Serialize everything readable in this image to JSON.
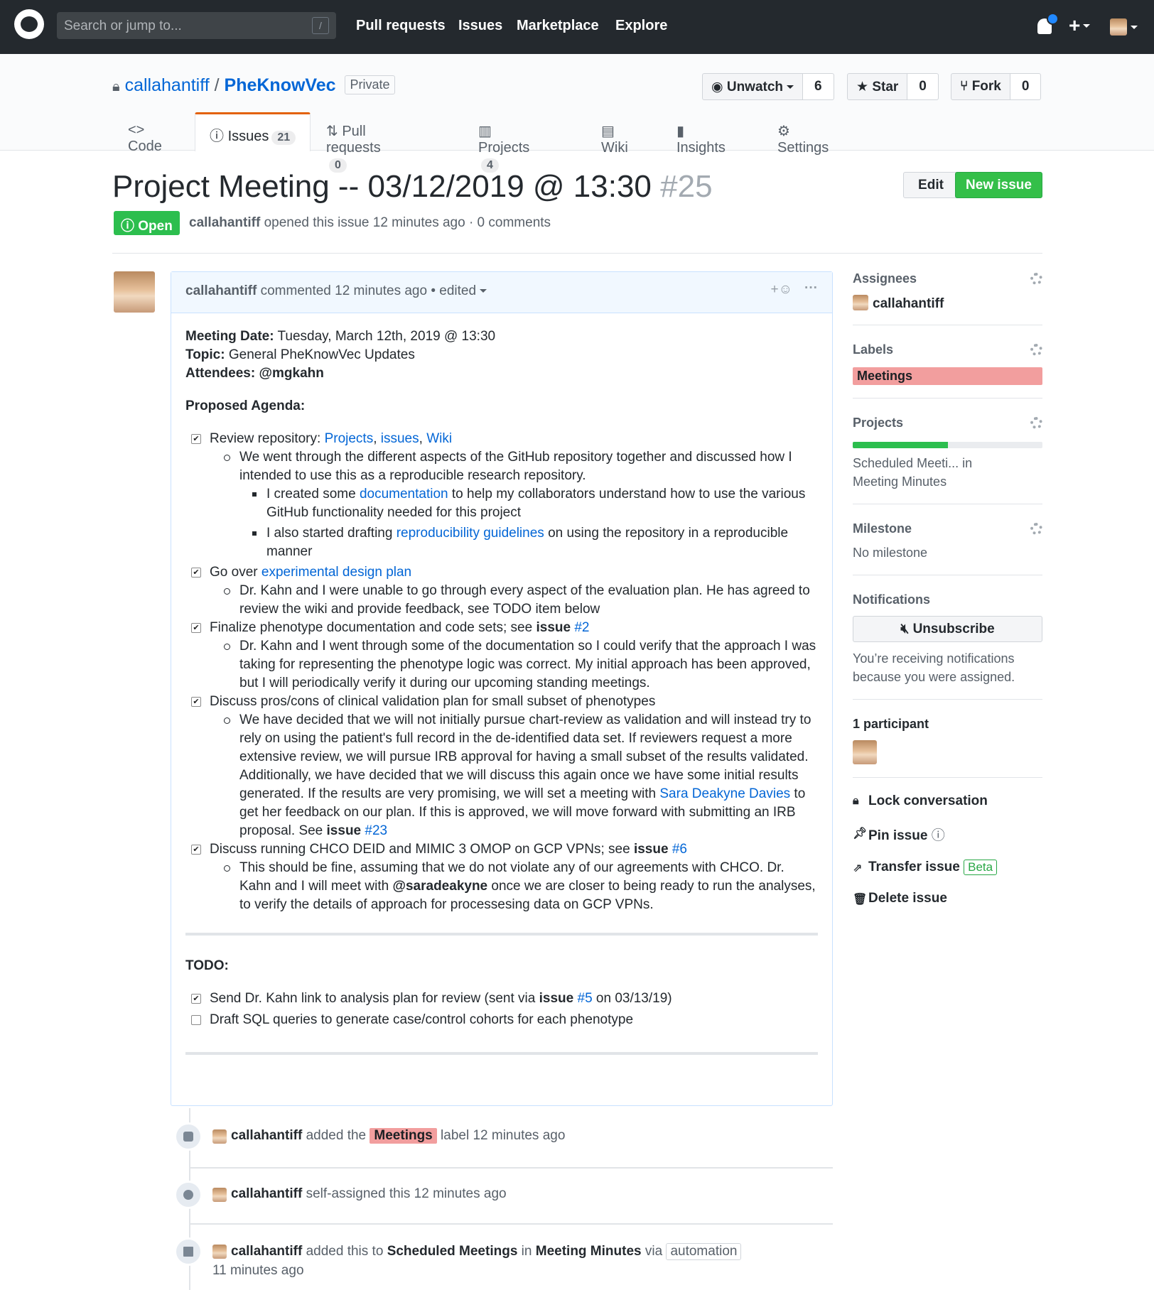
{
  "header": {
    "search_placeholder": "Search or jump to...",
    "slash": "/",
    "nav": [
      "Pull requests",
      "Issues",
      "Marketplace",
      "Explore"
    ],
    "plus": "+"
  },
  "repo": {
    "owner": "callahantiff",
    "sep": "/",
    "name": "PheKnowVec",
    "visibility": "Private",
    "unwatch": "Unwatch",
    "watch_count": "6",
    "star": "Star",
    "star_count": "0",
    "fork": "Fork",
    "fork_count": "0"
  },
  "tabs": [
    {
      "label": "Code",
      "count": ""
    },
    {
      "label": "Issues",
      "count": "21"
    },
    {
      "label": "Pull requests",
      "count": "0"
    },
    {
      "label": "Projects",
      "count": "4"
    },
    {
      "label": "Wiki",
      "count": ""
    },
    {
      "label": "Insights",
      "count": ""
    },
    {
      "label": "Settings",
      "count": ""
    }
  ],
  "issue": {
    "title": "Project Meeting -- 03/12/2019 @ 13:30",
    "number": "#25",
    "edit": "Edit",
    "new_issue": "New issue",
    "state": "Open",
    "author": "callahantiff",
    "meta": "opened this issue 12 minutes ago · 0 comments"
  },
  "comment": {
    "author": "callahantiff",
    "action": "commented 12 minutes ago • edited",
    "reaction": "+☺",
    "more": "···",
    "meeting_date_label": "Meeting Date:",
    "meeting_date": "Tuesday, March 12th, 2019 @ 13:30",
    "topic_label": "Topic:",
    "topic": "General PheKnowVec Updates",
    "attendees_label": "Attendees:",
    "attendees": "@mgkahn",
    "agenda_label": "Proposed Agenda:",
    "t1a": "Review repository: ",
    "t1_links": [
      "Projects",
      "issues",
      "Wiki"
    ],
    "comma": ", ",
    "t1_sub": "We went through the different aspects of the GitHub repository together and discussed how I intended to use this as a reproducible research repository.",
    "t1_s1a": "I created some ",
    "t1_s1link": "documentation",
    "t1_s1b": " to help my collaborators understand how to use the various GitHub functionality needed for this project",
    "t1_s2a": "I also started drafting ",
    "t1_s2link": "reproducibility guidelines",
    "t1_s2b": " on using the repository in a reproducible manner",
    "t2a": "Go over ",
    "t2link": "experimental design plan",
    "t2_sub": "Dr. Kahn and I were unable to go through every aspect of the evaluation plan. He has agreed to review the wiki and provide feedback, see TODO item below",
    "t3a": "Finalize phenotype documentation and code sets; see ",
    "issue_word": "issue",
    "t3link": "#2",
    "t3_sub": "Dr. Kahn and I went through some of the documentation so I could verify that the approach I was taking for representing the phenotype logic was correct. My initial approach has been approved, but I will periodically verify it during our upcoming standing meetings.",
    "t4a": "Discuss pros/cons of clinical validation plan for small subset of phenotypes",
    "t4_sub_a": "We have decided that we will not initially pursue chart-review as validation and will instead try to rely on using the patient's full record in the de-identified data set. If reviewers request a more extensive review, we will pursue IRB approval for having a small subset of the results validated. Additionally, we have decided that we will discuss this again once we have some initial results generated. If the results are very promising, we will set a meeting with ",
    "t4_link": "Sara Deakyne Davies",
    "t4_sub_b": " to get her feedback on our plan. If this is approved, we will move forward with submitting an IRB proposal. See ",
    "t4_issue_link": "#23",
    "t5a": "Discuss running CHCO DEID and MIMIC 3 OMOP on GCP VPNs; see ",
    "t5link": "#6",
    "t5_sub_a": "This should be fine, assuming that we do not violate any of our agreements with CHCO. Dr. Kahn and I will meet with ",
    "t5_mention": "@saradeakyne",
    "t5_sub_b": " once we are closer to being ready to run the analyses, to verify the details of approach for processesing data on GCP VPNs.",
    "todo_label": "TODO:",
    "todo1a": "Send Dr. Kahn link to analysis plan for review (sent via ",
    "todo1link": "#5",
    "todo1b": " on 03/13/19)",
    "todo2": "Draft SQL queries to generate case/control cohorts for each phenotype",
    "check": "✔"
  },
  "timeline": [
    {
      "user": "callahantiff",
      "a": "added the",
      "label": "Meetings",
      "b": "label 12 minutes ago"
    },
    {
      "user": "callahantiff",
      "a": "self-assigned this 12 minutes ago"
    },
    {
      "user": "callahantiff",
      "a": "added this to",
      "column": "Scheduled Meetings",
      "in": "in",
      "project": "Meeting Minutes",
      "via": "via",
      "tag": "automation",
      "time": "11 minutes ago"
    }
  ],
  "sidebar": {
    "assignees": "Assignees",
    "assignee": "callahantiff",
    "labels": "Labels",
    "label": "Meetings",
    "label_color": "#f29e9e",
    "projects": "Projects",
    "project_progress": 0.5,
    "project_line1": "Scheduled Meeti...  in",
    "project_line2": "Meeting Minutes",
    "milestone": "Milestone",
    "no_milestone": "No milestone",
    "notifications": "Notifications",
    "unsubscribe": "Unsubscribe",
    "notif_text1": "You’re receiving notifications",
    "notif_text2": "because you were assigned.",
    "participants": "1 participant",
    "lock": "Lock conversation",
    "pin": "Pin issue",
    "transfer": "Transfer issue",
    "beta": "Beta",
    "delete": "Delete issue"
  }
}
